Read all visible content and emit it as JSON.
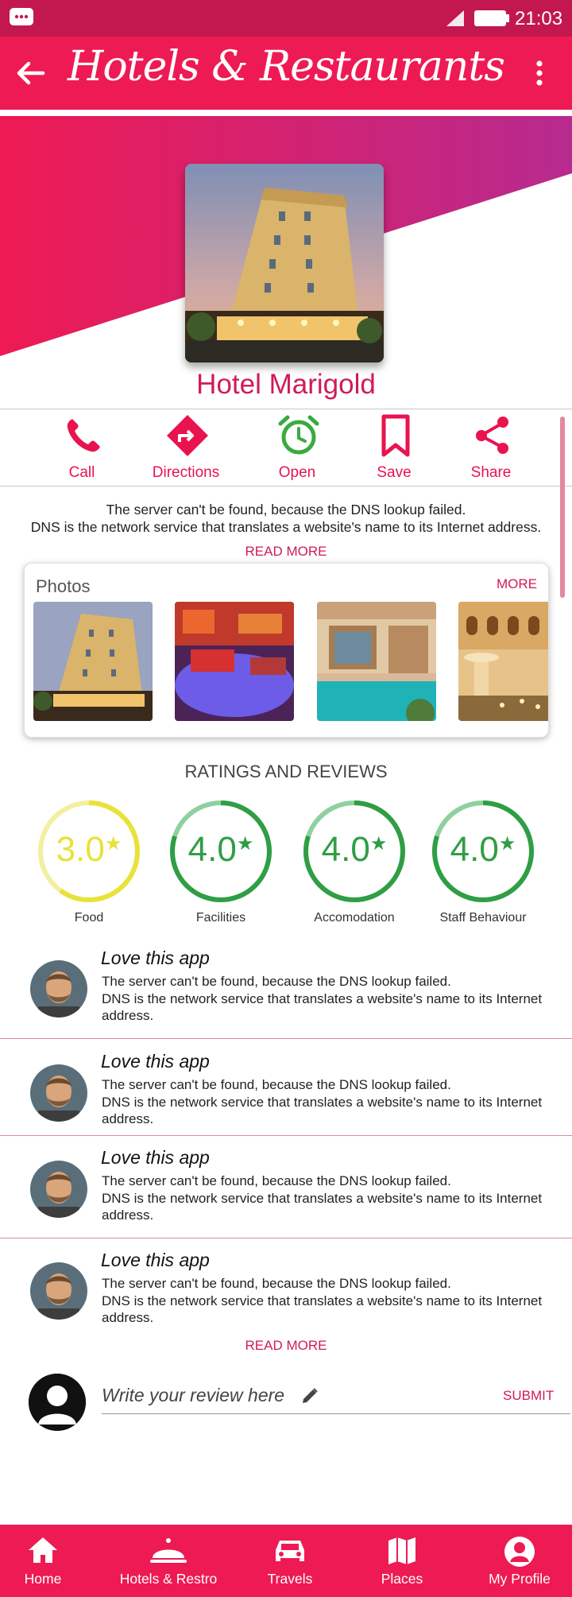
{
  "status_bar": {
    "time": "21:03"
  },
  "app_bar": {
    "title": "Hotels & Restaurants"
  },
  "hotel": {
    "name": "Hotel Marigold"
  },
  "actions": [
    {
      "label": "Call",
      "icon": "phone-icon"
    },
    {
      "label": "Directions",
      "icon": "directions-icon"
    },
    {
      "label": "Open",
      "icon": "alarm-clock-icon"
    },
    {
      "label": "Save",
      "icon": "bookmark-icon"
    },
    {
      "label": "Share",
      "icon": "share-icon"
    }
  ],
  "description": {
    "line1": "The server can't be found, because the DNS lookup failed.",
    "line2": "DNS is the network service that translates a website's name to its Internet address.",
    "read_more": "READ MORE"
  },
  "photos": {
    "title": "Photos",
    "more": "MORE"
  },
  "ratings": {
    "title": "RATINGS AND REVIEWS",
    "items": [
      {
        "value": "3.0",
        "label": "Food",
        "color": "#e8e23a",
        "fraction": 0.6
      },
      {
        "value": "4.0",
        "label": "Facilities",
        "color": "#2f9e44",
        "fraction": 0.8
      },
      {
        "value": "4.0",
        "label": "Accomodation",
        "color": "#2f9e44",
        "fraction": 0.8
      },
      {
        "value": "4.0",
        "label": "Staff Behaviour",
        "color": "#2f9e44",
        "fraction": 0.8
      }
    ]
  },
  "reviews": [
    {
      "title": "Love this app",
      "line1": "The server can't be found, because the DNS lookup failed.",
      "line2": "DNS is the network service that translates a website's name to its Internet address."
    },
    {
      "title": "Love this app",
      "line1": "The server can't be found, because the DNS lookup failed.",
      "line2": "DNS is the network service that translates a website's name to its Internet address."
    },
    {
      "title": "Love this app",
      "line1": "The server can't be found, because the DNS lookup failed.",
      "line2": "DNS is the network service that translates a website's name to its Internet address."
    },
    {
      "title": "Love this app",
      "line1": "The server can't be found, because the DNS lookup failed.",
      "line2": "DNS is the network service that translates a website's name to its Internet address."
    }
  ],
  "reviews_read_more": "READ MORE",
  "write_review": {
    "placeholder": "Write your review here",
    "submit": "SUBMIT"
  },
  "bottom_nav": [
    {
      "label": "Home",
      "icon": "home-icon"
    },
    {
      "label": "Hotels & Restro",
      "icon": "cloche-icon"
    },
    {
      "label": "Travels",
      "icon": "car-icon"
    },
    {
      "label": "Places",
      "icon": "map-icon"
    },
    {
      "label": "My Profile",
      "icon": "profile-icon"
    }
  ],
  "colors": {
    "primary": "#ee1a53",
    "accent_text": "#d11a58",
    "open_green": "#3aaa3f",
    "gradient_end": "#b72a8f"
  }
}
